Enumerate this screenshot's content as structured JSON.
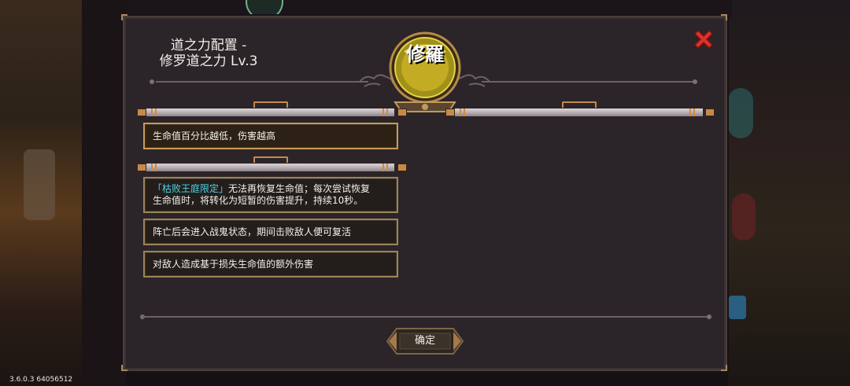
{
  "version": "3.6.0.3 64056512",
  "dialog": {
    "title_line1": "道之力配置 -",
    "title_line2": "修罗道之力 Lv.3",
    "emblem_text": "修羅",
    "close_label": "✖",
    "confirm_label": "确定"
  },
  "effects": {
    "primary": "生命值百分比越低，伤害越高",
    "secondary": [
      {
        "highlight": "「枯败王庭限定」",
        "text_line1": "无法再恢复生命值；每次尝试恢复",
        "text_line2": "生命值时，将转化为短暂的伤害提升，持续10秒。"
      },
      {
        "text": "阵亡后会进入战鬼状态，期间击败敌人便可复活"
      },
      {
        "text": "对敌人造成基于损失生命值的额外伤害"
      }
    ]
  },
  "colors": {
    "panel_bg": "#2b2429",
    "highlight": "#4fd3e0",
    "close_red": "#e0302a",
    "emblem_gold": "#c9b227",
    "frame_gold": "#9c8458"
  }
}
